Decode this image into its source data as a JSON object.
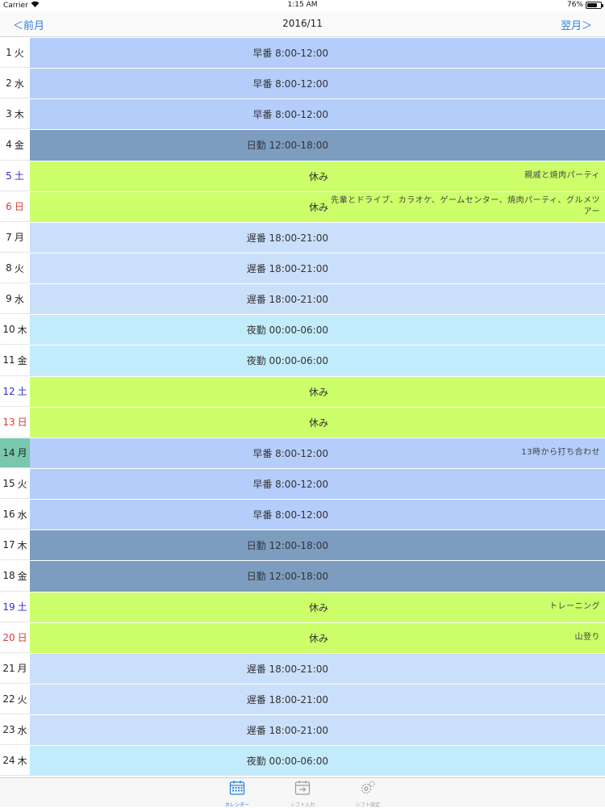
{
  "status": {
    "carrier": "Carrier",
    "time": "1:15 AM",
    "battery": "76%",
    "battery_level": 0.76
  },
  "nav": {
    "prev_label": "＜前月",
    "title": "2016/11",
    "next_label": "翌月＞"
  },
  "colors": {
    "early": "#b4cdfa",
    "day": "#7d9dc0",
    "off": "#ccff6a",
    "late": "#cadffa",
    "night": "#c2ebfb",
    "today": "#79c7ae",
    "accent": "#2a7fe0"
  },
  "rows": [
    {
      "date": "1",
      "weekday": "火",
      "kind": "weekday",
      "shift": "早番 8:00-12:00",
      "type": "early",
      "note": ""
    },
    {
      "date": "2",
      "weekday": "水",
      "kind": "weekday",
      "shift": "早番 8:00-12:00",
      "type": "early",
      "note": ""
    },
    {
      "date": "3",
      "weekday": "木",
      "kind": "weekday",
      "shift": "早番 8:00-12:00",
      "type": "early",
      "note": ""
    },
    {
      "date": "4",
      "weekday": "金",
      "kind": "weekday",
      "shift": "日勤 12:00-18:00",
      "type": "day",
      "note": ""
    },
    {
      "date": "5",
      "weekday": "土",
      "kind": "sat",
      "shift": "休み",
      "type": "off",
      "note": "親戚と焼肉パーティ"
    },
    {
      "date": "6",
      "weekday": "日",
      "kind": "sun",
      "shift": "休み",
      "type": "off",
      "note": "先輩とドライブ、カラオケ、ゲームセンター、焼肉パーティ、グルメツアー"
    },
    {
      "date": "7",
      "weekday": "月",
      "kind": "weekday",
      "shift": "遅番 18:00-21:00",
      "type": "late",
      "note": ""
    },
    {
      "date": "8",
      "weekday": "火",
      "kind": "weekday",
      "shift": "遅番 18:00-21:00",
      "type": "late",
      "note": ""
    },
    {
      "date": "9",
      "weekday": "水",
      "kind": "weekday",
      "shift": "遅番 18:00-21:00",
      "type": "late",
      "note": ""
    },
    {
      "date": "10",
      "weekday": "木",
      "kind": "weekday",
      "shift": "夜勤 00:00-06:00",
      "type": "night",
      "note": ""
    },
    {
      "date": "11",
      "weekday": "金",
      "kind": "weekday",
      "shift": "夜勤 00:00-06:00",
      "type": "night",
      "note": ""
    },
    {
      "date": "12",
      "weekday": "土",
      "kind": "sat",
      "shift": "休み",
      "type": "off",
      "note": ""
    },
    {
      "date": "13",
      "weekday": "日",
      "kind": "sun",
      "shift": "休み",
      "type": "off",
      "note": ""
    },
    {
      "date": "14",
      "weekday": "月",
      "kind": "today",
      "shift": "早番 8:00-12:00",
      "type": "early",
      "note": "13時から打ち合わせ"
    },
    {
      "date": "15",
      "weekday": "火",
      "kind": "weekday",
      "shift": "早番 8:00-12:00",
      "type": "early",
      "note": ""
    },
    {
      "date": "16",
      "weekday": "水",
      "kind": "weekday",
      "shift": "早番 8:00-12:00",
      "type": "early",
      "note": ""
    },
    {
      "date": "17",
      "weekday": "木",
      "kind": "weekday",
      "shift": "日勤 12:00-18:00",
      "type": "day",
      "note": ""
    },
    {
      "date": "18",
      "weekday": "金",
      "kind": "weekday",
      "shift": "日勤 12:00-18:00",
      "type": "day",
      "note": ""
    },
    {
      "date": "19",
      "weekday": "土",
      "kind": "sat",
      "shift": "休み",
      "type": "off",
      "note": "トレーニング"
    },
    {
      "date": "20",
      "weekday": "日",
      "kind": "sun",
      "shift": "休み",
      "type": "off",
      "note": "山登り"
    },
    {
      "date": "21",
      "weekday": "月",
      "kind": "weekday",
      "shift": "遅番 18:00-21:00",
      "type": "late",
      "note": ""
    },
    {
      "date": "22",
      "weekday": "火",
      "kind": "weekday",
      "shift": "遅番 18:00-21:00",
      "type": "late",
      "note": ""
    },
    {
      "date": "23",
      "weekday": "水",
      "kind": "weekday",
      "shift": "遅番 18:00-21:00",
      "type": "late",
      "note": ""
    },
    {
      "date": "24",
      "weekday": "木",
      "kind": "weekday",
      "shift": "夜勤 00:00-06:00",
      "type": "night",
      "note": ""
    }
  ],
  "tabs": [
    {
      "label": "カレンダー",
      "icon": "calendar-icon",
      "active": true
    },
    {
      "label": "シフト入力",
      "icon": "shift-input-icon",
      "active": false
    },
    {
      "label": "シフト設定",
      "icon": "gear-icon",
      "active": false
    }
  ]
}
